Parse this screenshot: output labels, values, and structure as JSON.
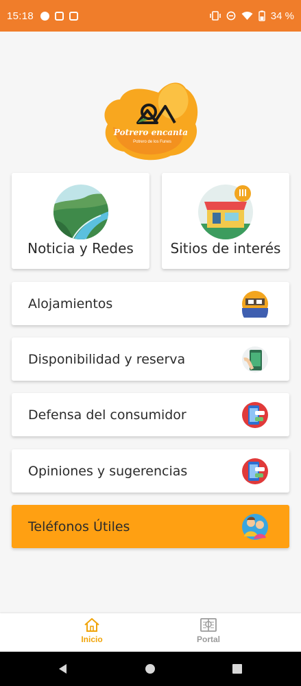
{
  "status_bar": {
    "time": "15:18",
    "battery": "34 %"
  },
  "logo": {
    "title": "Potrero encanta",
    "subtitle": "Potrero de los Funes"
  },
  "tiles": [
    {
      "label": "Noticia y Redes",
      "icon": "landscape-river-icon"
    },
    {
      "label": "Sitios de interés",
      "icon": "shop-storefront-icon"
    }
  ],
  "menu": [
    {
      "label": "Alojamientos",
      "icon": "hotel-bed-icon"
    },
    {
      "label": "Disponibilidad y reserva",
      "icon": "booking-phone-icon"
    },
    {
      "label": "Defensa del consumidor",
      "icon": "mobile-chat-icon"
    },
    {
      "label": "Opiniones y sugerencias",
      "icon": "mobile-chat-icon"
    },
    {
      "label": "Teléfonos Útiles",
      "icon": "people-icon"
    }
  ],
  "bottom_nav": [
    {
      "label": "Inicio",
      "icon": "home-icon",
      "active": true
    },
    {
      "label": "Portal",
      "icon": "map-book-icon",
      "active": false
    }
  ],
  "colors": {
    "status_bar": "#f07d2a",
    "accent_row": "#ffa012",
    "active_nav": "#f0a40a",
    "inactive_nav": "#9a9a9a"
  }
}
